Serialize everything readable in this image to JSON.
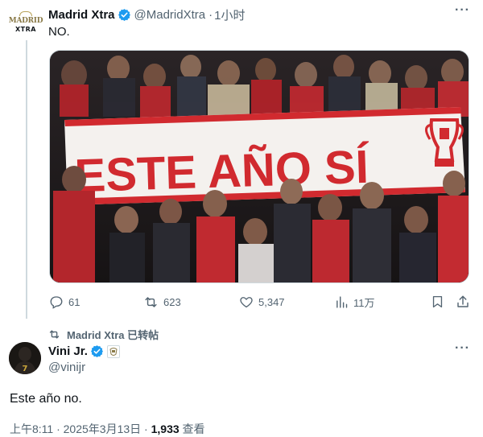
{
  "colors": {
    "accent": "#1d9bf0",
    "text_primary": "#0f1419",
    "text_secondary": "#536471",
    "divider": "#cfd9de",
    "banner_red": "#d12a2f"
  },
  "tweet": {
    "author": {
      "name": "Madrid Xtra",
      "handle": "@MadridXtra",
      "separator": "·",
      "time": "1小时",
      "avatar_text_top": "MADRID",
      "avatar_text_bottom": "XTRA"
    },
    "text": "NO.",
    "media": {
      "banner_text": "ESTE AÑO SÍ"
    },
    "actions": {
      "replies": "61",
      "retweets": "623",
      "likes": "5,347",
      "views": "11万"
    }
  },
  "retweet_note": {
    "text": "Madrid Xtra 已转帖",
    "icon": "retweet-icon"
  },
  "quoted": {
    "name": "Vini Jr.",
    "handle": "@vinijr",
    "text": "Este año no.",
    "timestamp_prefix": "上午8:11 · 2025年3月13日 · ",
    "views_count": "1,933",
    "views_label": " 查看"
  }
}
